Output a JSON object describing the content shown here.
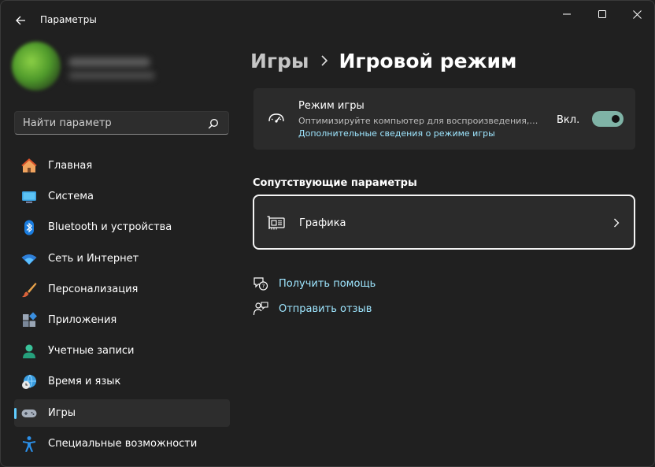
{
  "window": {
    "title": "Параметры"
  },
  "sidebar": {
    "search": {
      "placeholder": "Найти параметр"
    },
    "items": [
      {
        "label": "Главная",
        "icon": "home-icon"
      },
      {
        "label": "Система",
        "icon": "system-icon"
      },
      {
        "label": "Bluetooth и устройства",
        "icon": "bluetooth-icon"
      },
      {
        "label": "Сеть и Интернет",
        "icon": "wifi-icon"
      },
      {
        "label": "Персонализация",
        "icon": "brush-icon"
      },
      {
        "label": "Приложения",
        "icon": "apps-icon"
      },
      {
        "label": "Учетные записи",
        "icon": "account-icon"
      },
      {
        "label": "Время и язык",
        "icon": "time-language-icon"
      },
      {
        "label": "Игры",
        "icon": "gamepad-icon",
        "active": true
      },
      {
        "label": "Специальные возможности",
        "icon": "accessibility-icon"
      }
    ]
  },
  "main": {
    "breadcrumb": {
      "parent": "Игры",
      "current": "Игровой режим"
    },
    "game_mode_card": {
      "title": "Режим игры",
      "description": "Оптимизируйте компьютер для воспроизведения, от...",
      "link": "Дополнительные сведения о режиме игры",
      "toggle_state": "Вкл.",
      "toggle_on": true
    },
    "related_section_title": "Сопутствующие параметры",
    "graphics_row_label": "Графика",
    "help_links": [
      {
        "label": "Получить помощь",
        "icon": "help-icon"
      },
      {
        "label": "Отправить отзыв",
        "icon": "feedback-icon"
      }
    ]
  },
  "colors": {
    "accent": "#60cdff",
    "link": "#9ee6ff",
    "background": "#202020",
    "card": "#2b2b2b",
    "toggle_on": "#7fb3a6"
  }
}
